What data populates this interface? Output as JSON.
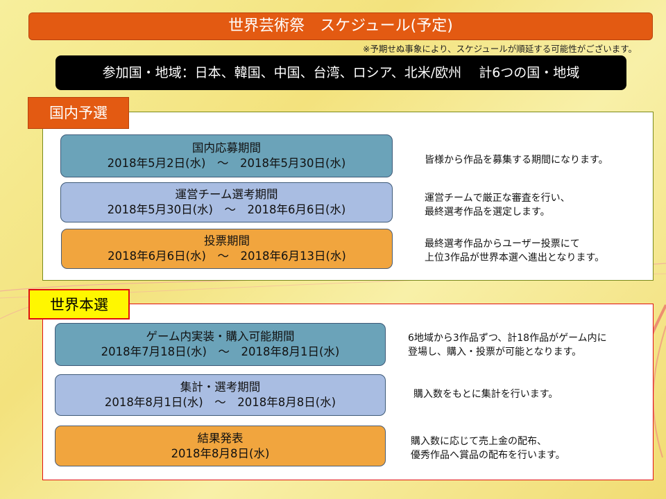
{
  "header": {
    "title": "世界芸術祭　スケジュール(予定)",
    "note": "※予期せぬ事象により、スケジュールが順延する可能性がございます。"
  },
  "countries": "参加国・地域：日本、韓国、中国、台湾、ロシア、北米/欧州　 計6つの国・地域",
  "domestic": {
    "label": "国内予選",
    "items": [
      {
        "title": "国内応募期間",
        "dates": "2018年5月2日(水)　～　2018年5月30日(水)",
        "desc": [
          "皆様から作品を募集する期間になります。"
        ]
      },
      {
        "title": "運営チーム選考期間",
        "dates": "2018年5月30日(水)　～　2018年6月6日(水)",
        "desc": [
          "運営チームで厳正な審査を行い、",
          "最終選考作品を選定します。"
        ]
      },
      {
        "title": "投票期間",
        "dates": "2018年6月6日(水)　～　2018年6月13日(水)",
        "desc": [
          "最終選考作品からユーザー投票にて",
          "上位3作品が世界本選へ進出となります。"
        ]
      }
    ]
  },
  "world": {
    "label": "世界本選",
    "items": [
      {
        "title": "ゲーム内実装・購入可能期間",
        "dates": "2018年7月18日(水)　～　2018年8月1日(水)",
        "desc": [
          "6地域から3作品ずつ、計18作品がゲーム内に",
          "登場し、購入・投票が可能となります。"
        ]
      },
      {
        "title": "集計・選考期間",
        "dates": "2018年8月1日(水)　～　2018年8月8日(水)",
        "desc": [
          "購入数をもとに集計を行います。"
        ]
      },
      {
        "title": "結果発表",
        "dates": "2018年8月8日(水)",
        "desc": [
          "購入数に応じて売上金の配布、",
          "優秀作品へ賞品の配布を行います。"
        ]
      }
    ]
  }
}
